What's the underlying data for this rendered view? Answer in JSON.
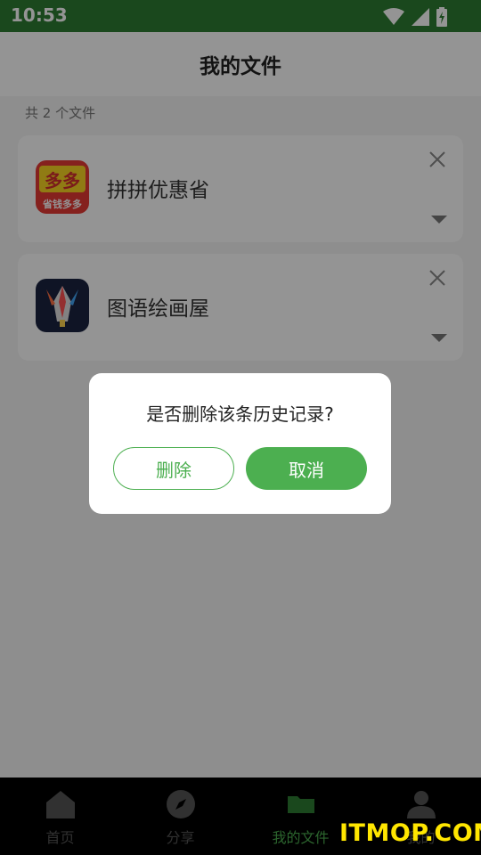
{
  "status_bar": {
    "time": "10:53"
  },
  "header": {
    "title": "我的文件"
  },
  "list": {
    "count_label": "共 2 个文件",
    "items": [
      {
        "name": "拼拼优惠省",
        "icon": "duoduo-app-icon",
        "icon_text": "多多",
        "icon_subtext": "省钱多多"
      },
      {
        "name": "图语绘画屋",
        "icon": "paint-pen-app-icon"
      }
    ]
  },
  "dialog": {
    "message": "是否删除该条历史记录?",
    "delete_label": "删除",
    "cancel_label": "取消"
  },
  "bottom_nav": {
    "items": [
      {
        "label": "首页",
        "icon": "home-icon"
      },
      {
        "label": "分享",
        "icon": "compass-icon"
      },
      {
        "label": "我的文件",
        "icon": "folder-icon",
        "active": true
      },
      {
        "label": "我的",
        "icon": "person-icon"
      }
    ]
  },
  "watermark": "ITMOP.COM",
  "colors": {
    "accent": "#4caf50",
    "status_bar": "#2e7d32",
    "nav_bg": "#000000"
  }
}
